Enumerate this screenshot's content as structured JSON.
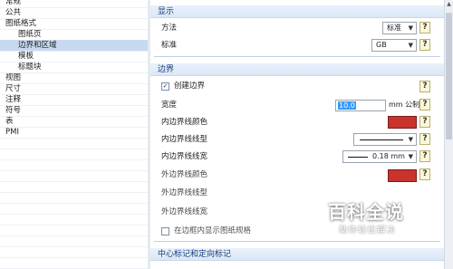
{
  "tree": {
    "items": [
      {
        "label": "常规",
        "indent": 0,
        "selected": false
      },
      {
        "label": "公共",
        "indent": 0,
        "selected": false
      },
      {
        "label": "图纸格式",
        "indent": 0,
        "selected": false
      },
      {
        "label": "图纸页",
        "indent": 1,
        "selected": false
      },
      {
        "label": "边界和区域",
        "indent": 1,
        "selected": true
      },
      {
        "label": "模板",
        "indent": 1,
        "selected": false
      },
      {
        "label": "标题块",
        "indent": 1,
        "selected": false
      },
      {
        "label": "视图",
        "indent": 0,
        "selected": false
      },
      {
        "label": "尺寸",
        "indent": 0,
        "selected": false
      },
      {
        "label": "注释",
        "indent": 0,
        "selected": false
      },
      {
        "label": "符号",
        "indent": 0,
        "selected": false
      },
      {
        "label": "表",
        "indent": 0,
        "selected": false
      },
      {
        "label": "PMI",
        "indent": 0,
        "selected": false
      }
    ]
  },
  "display_section": {
    "title": "显示",
    "method_label": "方法",
    "method_value": "标准",
    "standard_label": "标准",
    "standard_value": "GB"
  },
  "border_section": {
    "title": "边界",
    "create_border_label": "创建边界",
    "create_border_checked": true,
    "width_label": "宽度",
    "width_value": "10.0",
    "width_unit": "mm 公制",
    "inner_color_label": "内边界线颜色",
    "inner_type_label": "内边界线线型",
    "inner_width_label": "内边界线线宽",
    "inner_width_value": "0.18 mm",
    "outer_color_label": "外边界线颜色",
    "outer_type_label": "外边界线线型",
    "outer_width_label": "外边界线线宽",
    "show_in_frame_label": "在边框内显示图纸规格",
    "show_in_frame_checked": false,
    "border_color": "#c9332e"
  },
  "center_section": {
    "title": "中心标记和定向标记"
  },
  "help_glyph": "?",
  "dropdown_glyph": "▼",
  "check_glyph": "✓",
  "watermark": {
    "title": "百科全说",
    "subtitle": "助你轻松解决"
  }
}
